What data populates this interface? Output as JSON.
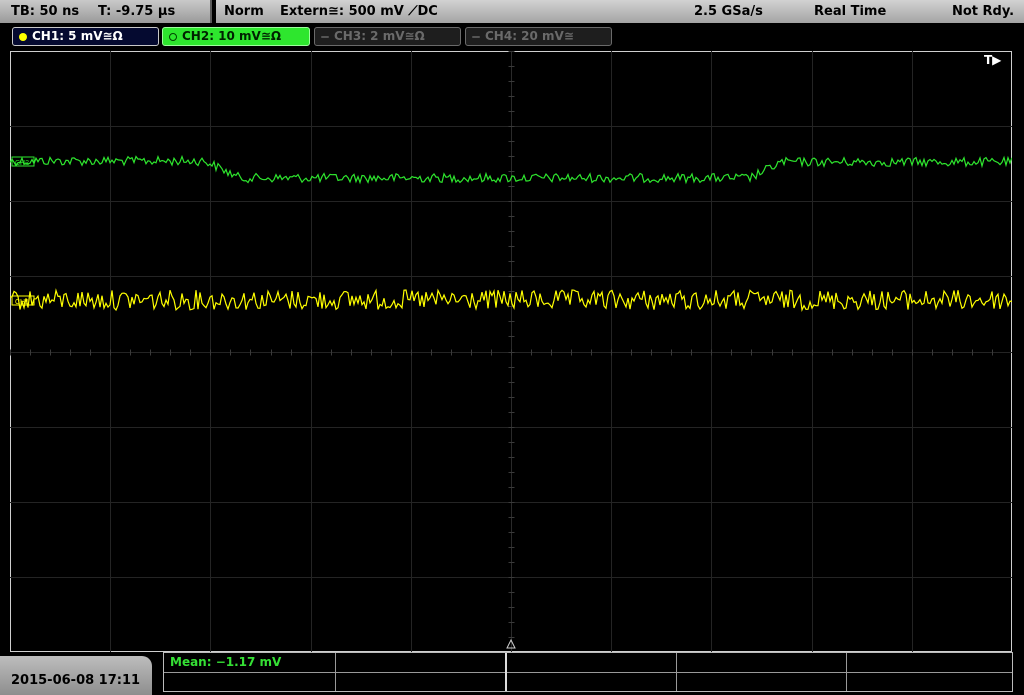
{
  "status": {
    "timebase": "TB: 50 ns",
    "trigger_time": "T: -9.75 µs",
    "trigger_mode": "Norm",
    "trigger_source": "Extern≅: 500 mV ⟋DC",
    "sample_rate": "2.5 GSa/s",
    "acq_mode": "Real Time",
    "state": "Not Rdy."
  },
  "channels": [
    {
      "label": "CH1: 5 mV≅Ω",
      "color": "#ffff00",
      "active": true
    },
    {
      "label": "CH2: 10 mV≅Ω",
      "color": "#2ee62e",
      "active": true
    },
    {
      "label": "CH3: 2 mV≅Ω",
      "color": "#6a6a6a",
      "active": false
    },
    {
      "label": "CH4: 20 mV≅",
      "color": "#6a6a6a",
      "active": false
    }
  ],
  "graticule": {
    "h_divisions": 10,
    "v_divisions": 8,
    "subdivisions": 5
  },
  "markers": {
    "trigger": "T▶",
    "ch2_ref": "CH2",
    "ch1_ref": "CH1"
  },
  "datetime": "2015-06-08 17:11",
  "measurement": {
    "text": "Mean: −1.17 mV"
  }
}
